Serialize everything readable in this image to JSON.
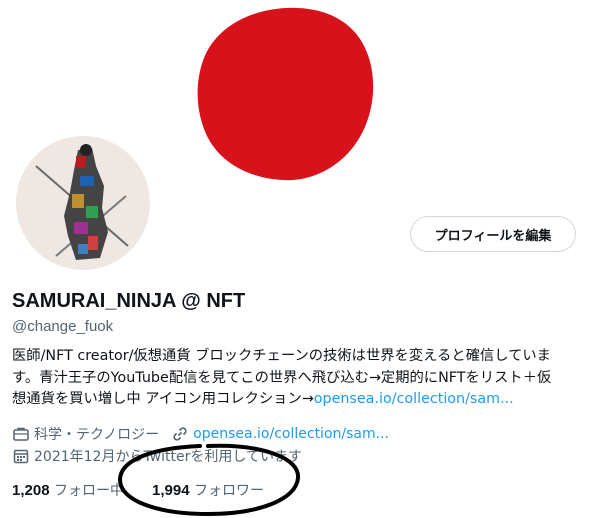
{
  "profile": {
    "edit_button": "プロフィールを編集",
    "display_name": "SAMURAI_NINJA @ NFT",
    "handle": "@change_fuok",
    "bio_lines": [
      "医師/NFT creator/仮想通貨 ブロックチェーンの技術は世界を変えると確信していま",
      "す。青汁王子のYouTube配信を見てこの世界へ飛び込む→定期的にNFTをリスト＋仮",
      "想通貨を買い増し中 アイコン用コレクション→"
    ],
    "bio_link": "opensea.io/collection/sam...",
    "category": "科学・テクノロジー",
    "website": "opensea.io/collection/sam...",
    "joined": "2021年12月からTwitterを利用しています",
    "following_count": "1,208",
    "following_label": "フォロー中",
    "followers_count": "1,994",
    "followers_label": "フォロワー"
  },
  "icons": [
    "briefcase-icon",
    "link-icon",
    "calendar-icon"
  ],
  "colors": {
    "banner_sun": "#d8121a",
    "link": "#1d9bf0",
    "secondary_text": "#536471",
    "annotation": "#000000"
  }
}
